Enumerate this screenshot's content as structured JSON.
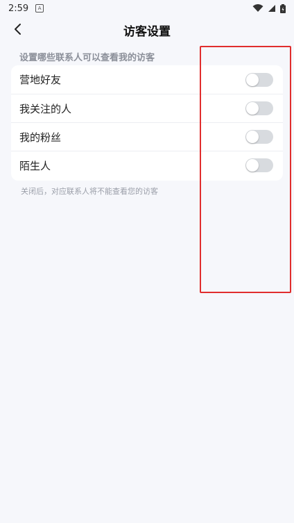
{
  "status_bar": {
    "time": "2:59",
    "notification_icon": "A",
    "icons": [
      "wifi-icon",
      "signal-icon",
      "battery-icon"
    ]
  },
  "header": {
    "title": "访客设置",
    "back_icon": "chevron-left-icon"
  },
  "section": {
    "label": "设置哪些联系人可以查看我的访客"
  },
  "settings": [
    {
      "label": "营地好友",
      "enabled": false
    },
    {
      "label": "我关注的人",
      "enabled": false
    },
    {
      "label": "我的粉丝",
      "enabled": false
    },
    {
      "label": "陌生人",
      "enabled": false
    }
  ],
  "footnote": "关闭后，对应联系人将不能查看您的访客",
  "colors": {
    "background": "#f6f7fb",
    "card": "#ffffff",
    "toggle_off": "#d8dbdf",
    "highlight": "#e02d2d"
  }
}
